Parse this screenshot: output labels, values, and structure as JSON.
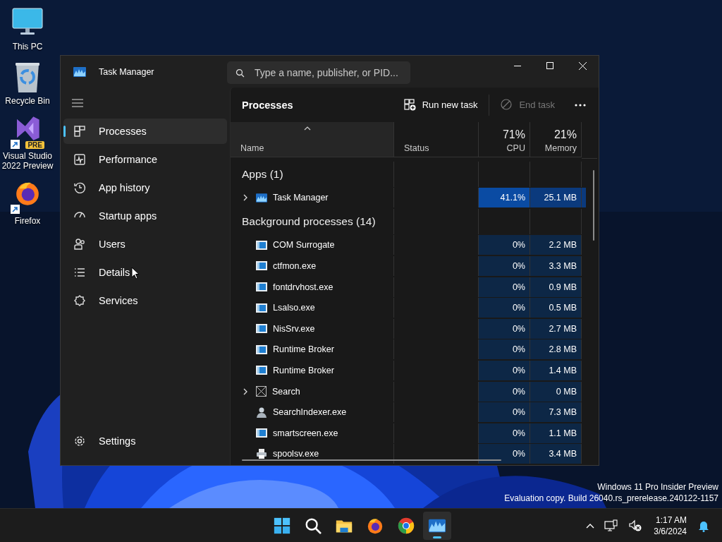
{
  "desktop": {
    "icons": [
      {
        "kind": "monitor",
        "label": "This PC"
      },
      {
        "kind": "recycle",
        "label": "Recycle Bin"
      },
      {
        "kind": "studio",
        "label": "Visual Studio 2022 Preview",
        "badge": "PRE",
        "shortcut": true
      },
      {
        "kind": "firefox",
        "label": "Firefox",
        "shortcut": true
      }
    ],
    "watermark": [
      "Windows 11 Pro Insider Preview",
      "Evaluation copy. Build 26040.rs_prerelease.240122-1157"
    ]
  },
  "window": {
    "title": "Task Manager",
    "search": {
      "placeholder": "Type a name, publisher, or PID..."
    },
    "nav": [
      {
        "kind": "processes",
        "label": "Processes",
        "selected": true
      },
      {
        "kind": "performance",
        "label": "Performance",
        "selected": false
      },
      {
        "kind": "history",
        "label": "App history",
        "selected": false
      },
      {
        "kind": "startup",
        "label": "Startup apps",
        "selected": false
      },
      {
        "kind": "users",
        "label": "Users",
        "selected": false
      },
      {
        "kind": "details",
        "label": "Details",
        "selected": false
      },
      {
        "kind": "services",
        "label": "Services",
        "selected": false
      }
    ],
    "settings": "Settings",
    "page_title": "Processes",
    "toolbar": [
      {
        "kind": "run",
        "label": "Run new task",
        "disabled": false
      },
      {
        "kind": "end",
        "label": "End task",
        "disabled": true
      }
    ],
    "table": {
      "columns": [
        {
          "label": "Name",
          "sorted": true
        },
        {
          "label": "Status"
        },
        {
          "label": "CPU",
          "total": "71%"
        },
        {
          "label": "Memory",
          "total": "21%"
        }
      ],
      "groups": [
        {
          "label": "Apps (1)",
          "rows": [
            {
              "kind": "taskmgr",
              "name": "Task Manager",
              "expandable": true,
              "cpu": "41.1%",
              "memory": "25.1 MB"
            }
          ]
        },
        {
          "label": "Background processes (14)",
          "rows": [
            {
              "kind": "app",
              "name": "COM Surrogate",
              "expandable": false,
              "cpu": "0%",
              "memory": "2.2 MB"
            },
            {
              "kind": "app",
              "name": "ctfmon.exe",
              "expandable": false,
              "cpu": "0%",
              "memory": "3.3 MB"
            },
            {
              "kind": "app",
              "name": "fontdrvhost.exe",
              "expandable": false,
              "cpu": "0%",
              "memory": "0.9 MB"
            },
            {
              "kind": "app",
              "name": "Lsalso.exe",
              "expandable": false,
              "cpu": "0%",
              "memory": "0.5 MB"
            },
            {
              "kind": "app",
              "name": "NisSrv.exe",
              "expandable": false,
              "cpu": "0%",
              "memory": "2.7 MB"
            },
            {
              "kind": "app",
              "name": "Runtime Broker",
              "expandable": false,
              "cpu": "0%",
              "memory": "2.8 MB"
            },
            {
              "kind": "app",
              "name": "Runtime Broker",
              "expandable": false,
              "cpu": "0%",
              "memory": "1.4 MB"
            },
            {
              "kind": "crossed",
              "name": "Search",
              "expandable": true,
              "cpu": "0%",
              "memory": "0 MB"
            },
            {
              "kind": "person",
              "name": "SearchIndexer.exe",
              "expandable": false,
              "cpu": "0%",
              "memory": "7.3 MB"
            },
            {
              "kind": "app",
              "name": "smartscreen.exe",
              "expandable": false,
              "cpu": "0%",
              "memory": "1.1 MB"
            },
            {
              "kind": "printer",
              "name": "spoolsv.exe",
              "expandable": false,
              "cpu": "0%",
              "memory": "3.4 MB"
            }
          ]
        }
      ]
    }
  },
  "taskbar": {
    "apps": [
      {
        "kind": "start",
        "active": false
      },
      {
        "kind": "search",
        "active": false
      },
      {
        "kind": "explorer",
        "active": false
      },
      {
        "kind": "firefox",
        "active": false
      },
      {
        "kind": "chrome",
        "active": false
      },
      {
        "kind": "taskmgr",
        "active": true
      }
    ],
    "time": "1:17 AM",
    "date": "3/6/2024"
  }
}
